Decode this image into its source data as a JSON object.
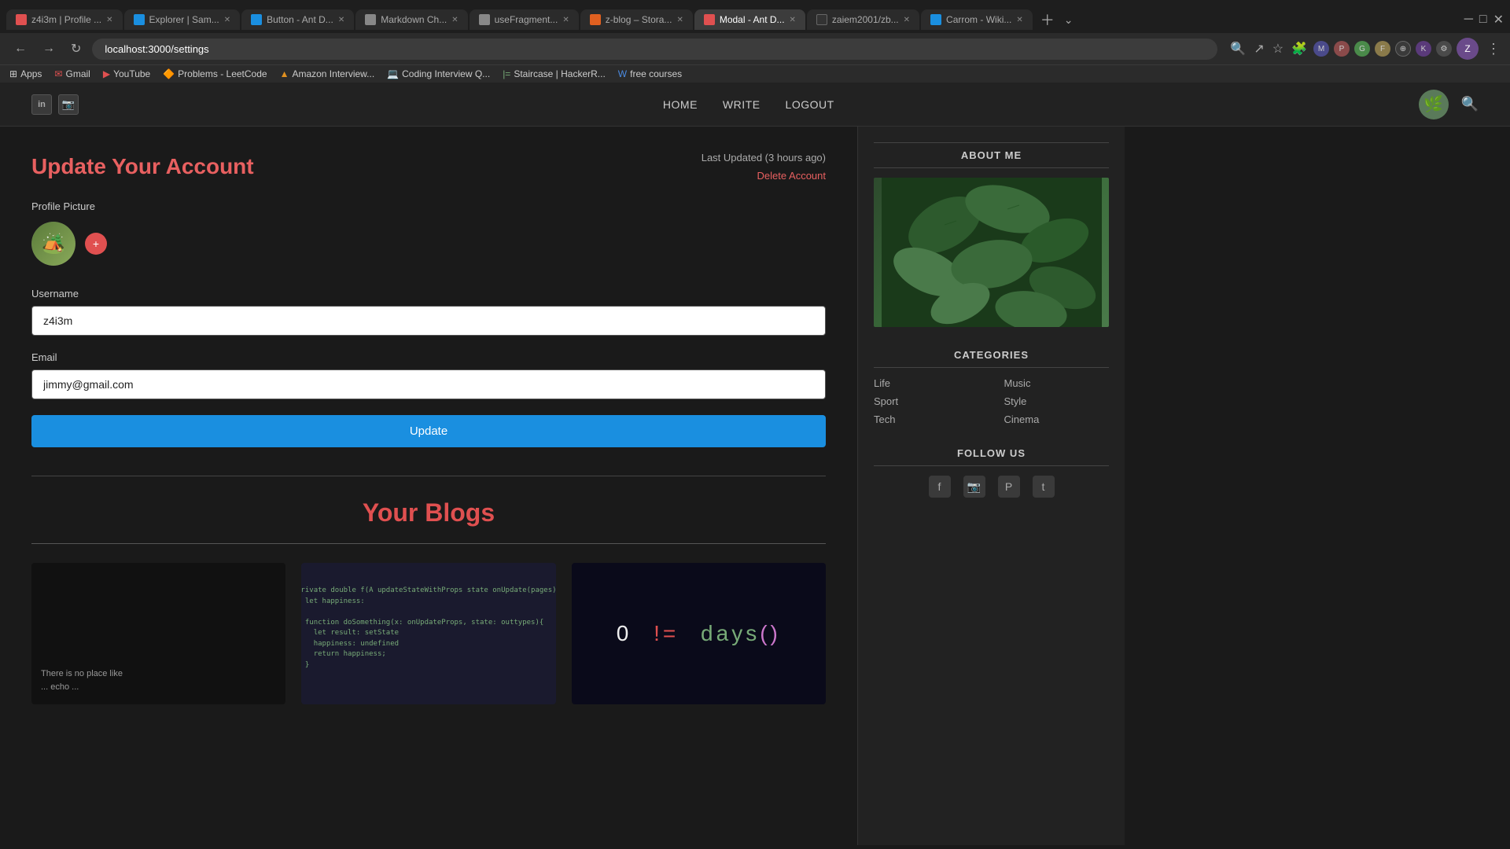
{
  "browser": {
    "tabs": [
      {
        "id": "tab1",
        "favicon_color": "#e05050",
        "label": "z4i3m | Profile ...",
        "active": false
      },
      {
        "id": "tab2",
        "favicon_color": "#1a8fe0",
        "label": "Explorer | Sam...",
        "active": false
      },
      {
        "id": "tab3",
        "favicon_color": "#1a8fe0",
        "label": "Button - Ant D...",
        "active": false
      },
      {
        "id": "tab4",
        "favicon_color": "#888",
        "label": "Markdown Ch...",
        "active": false
      },
      {
        "id": "tab5",
        "favicon_color": "#888",
        "label": "useFragment...",
        "active": false
      },
      {
        "id": "tab6",
        "favicon_color": "#e06020",
        "label": "z-blog – Stora...",
        "active": false
      },
      {
        "id": "tab7",
        "favicon_color": "#e05050",
        "label": "Modal - Ant D...",
        "active": true
      },
      {
        "id": "tab8",
        "favicon_color": "#333",
        "label": "zaiem2001/zb...",
        "active": false
      },
      {
        "id": "tab9",
        "favicon_color": "#1a8fe0",
        "label": "Carrom - Wiki...",
        "active": false
      }
    ],
    "address": "localhost:3000/settings",
    "bookmarks": [
      {
        "label": "Apps",
        "favicon": "grid"
      },
      {
        "label": "Gmail",
        "favicon": "mail"
      },
      {
        "label": "YouTube",
        "favicon": "yt"
      },
      {
        "label": "Problems - LeetCode",
        "favicon": "lc"
      },
      {
        "label": "Amazon Interview...",
        "favicon": "amz"
      },
      {
        "label": "Coding Interview Q...",
        "favicon": "ci"
      },
      {
        "label": "Staircase | HackerR...",
        "favicon": "hr"
      },
      {
        "label": "free courses",
        "favicon": "wp"
      }
    ]
  },
  "site_header": {
    "nav": [
      {
        "label": "HOME"
      },
      {
        "label": "WRITE"
      },
      {
        "label": "LOGOUT"
      }
    ],
    "linkedin_icon": "in",
    "camera_icon": "📷"
  },
  "settings": {
    "page_title": "Update Your Account",
    "last_updated": "Last Updated (3 hours ago)",
    "delete_link": "Delete Account",
    "profile_picture_label": "Profile Picture",
    "username_label": "Username",
    "username_value": "z4i3m",
    "email_label": "Email",
    "email_value": "jimmy@gmail.com",
    "update_button": "Update",
    "blogs_title": "Your Blogs"
  },
  "sidebar": {
    "about_title": "ABOUT ME",
    "categories_title": "CATEGORIES",
    "follow_title": "FOLLOW US",
    "categories": [
      {
        "label": "Life"
      },
      {
        "label": "Music"
      },
      {
        "label": "Sport"
      },
      {
        "label": "Style"
      },
      {
        "label": "Tech"
      },
      {
        "label": "Cinema"
      }
    ],
    "follow_icons": [
      "f",
      "i",
      "p",
      "t"
    ]
  },
  "blog_cards": [
    {
      "type": "dark_text",
      "preview_text": "There is no place like\n... echo ..."
    },
    {
      "type": "code"
    },
    {
      "type": "math"
    }
  ]
}
